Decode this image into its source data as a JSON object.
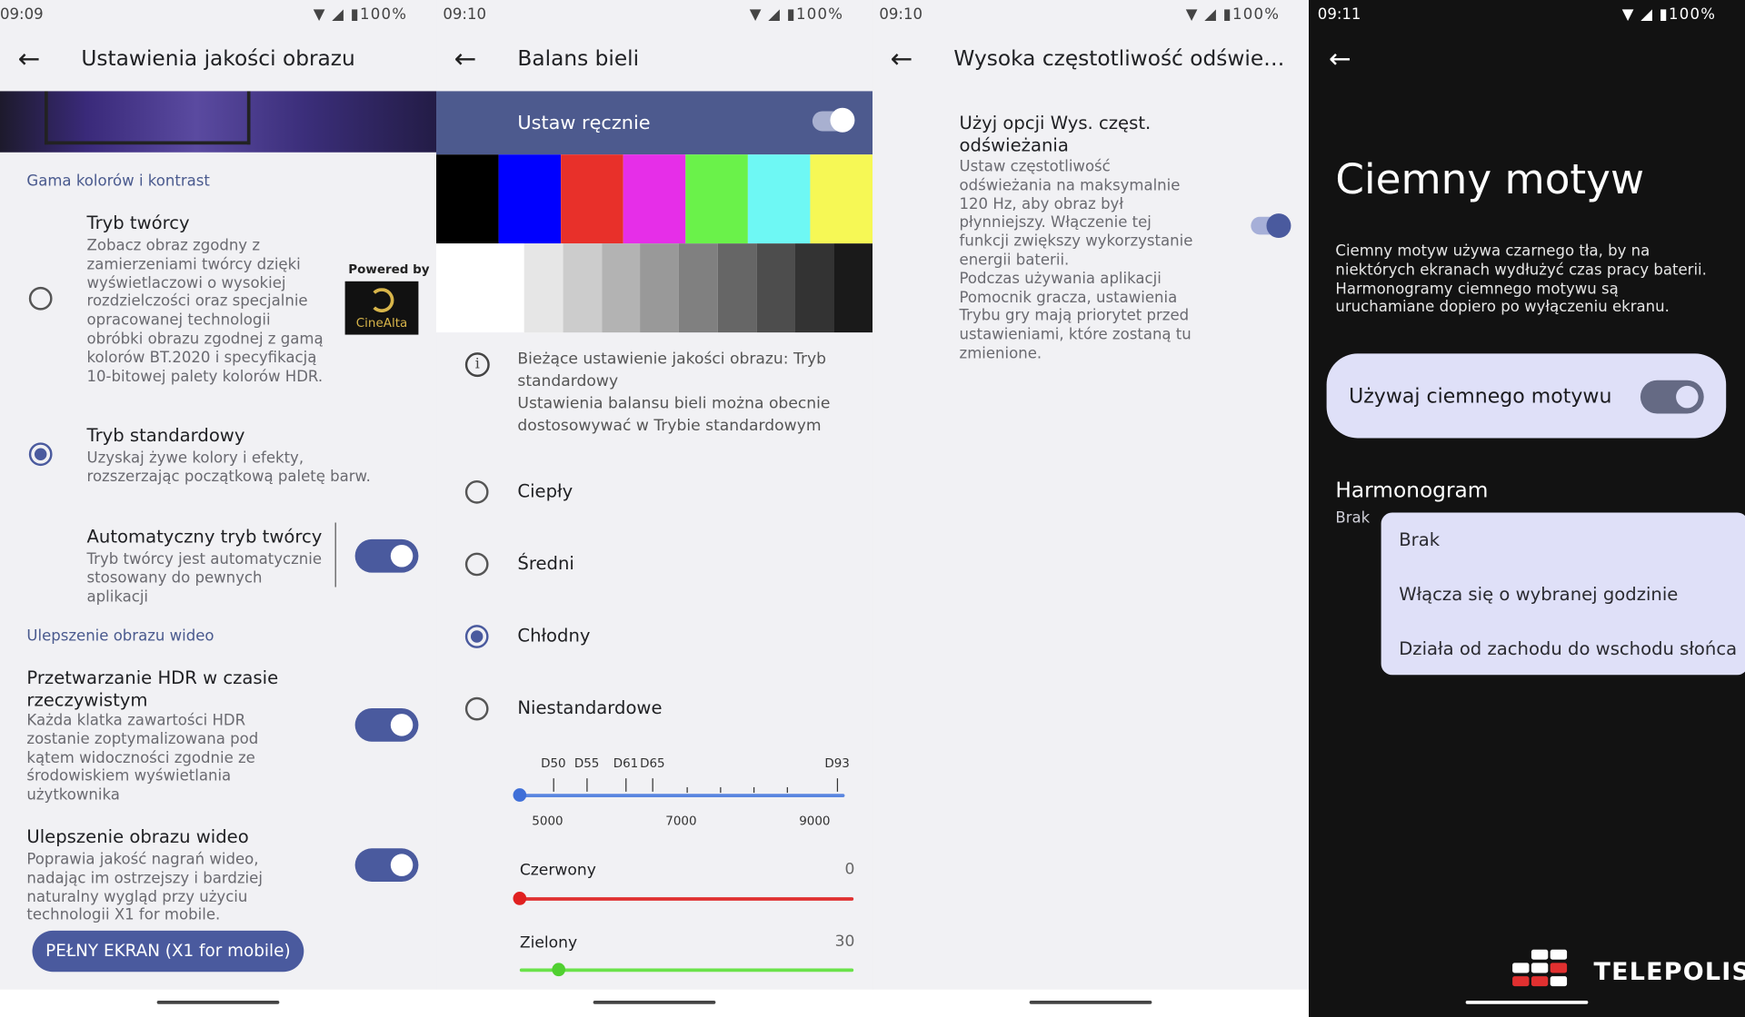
{
  "status": {
    "p1_time": "09:09",
    "p2_time": "09:10",
    "p3_time": "09:10",
    "p4_time": "09:11",
    "battery": "100%"
  },
  "p1": {
    "title": "Ustawienia jakości obrazu",
    "section1": "Gama kolorów i kontrast",
    "creator_title": "Tryb twórcy",
    "creator_desc": "Zobacz obraz zgodny z zamierzeniami twórcy dzięki wyświetlaczowi o wysokiej rozdzielczości oraz specjalnie opracowanej technologii obróbki obrazu zgodnej z gamą kolorów BT.2020 i specyfikacją 10-bitowej palety kolorów HDR.",
    "powered_by": "Powered by",
    "cinealta": "CineAlta",
    "standard_title": "Tryb standardowy",
    "standard_desc": "Uzyskaj żywe kolory i efekty, rozszerzając początkową paletę barw.",
    "auto_title": "Automatyczny tryb twórcy",
    "auto_desc": "Tryb twórcy jest automatycznie stosowany do pewnych aplikacji",
    "section2": "Ulepszenie obrazu wideo",
    "hdr_title": "Przetwarzanie HDR w czasie rzeczywistym",
    "hdr_desc": "Każda klatka zawartości HDR zostanie zoptymalizowana pod kątem widoczności zgodnie ze środowiskiem wyświetlania użytkownika",
    "video_title": "Ulepszenie obrazu wideo",
    "video_desc": "Poprawia jakość nagrań wideo, nadając im ostrzejszy i bardziej naturalny wygląd przy użyciu technologii X1 for mobile.",
    "fullscreen_button": "PEŁNY EKRAN (X1 for mobile)"
  },
  "p2": {
    "title": "Balans bieli",
    "manual_label": "Ustaw ręcznie",
    "info_text": "Bieżące ustawienie jakości obrazu: Tryb standardowy\nUstawienia balansu bieli można obecnie dostosowywać w Trybie standardowym",
    "options": [
      "Ciepły",
      "Średni",
      "Chłodny",
      "Niestandardowe"
    ],
    "selected_option": "Chłodny",
    "temp_labels": [
      "D50",
      "D55",
      "D61",
      "D65",
      "D93"
    ],
    "temp_scale": [
      "5000",
      "7000",
      "9000"
    ],
    "red_label": "Czerwony",
    "red_value": "0",
    "green_label": "Zielony",
    "green_value": "30",
    "color_bars": [
      "#000000",
      "#0000ff",
      "#e8302a",
      "#e62ee8",
      "#6af24a",
      "#6ef8f4",
      "#f6f855"
    ],
    "gray_bars": [
      "#ffffff",
      "#e6e6e6",
      "#cccccc",
      "#b3b3b3",
      "#999999",
      "#808080",
      "#666666",
      "#4d4d4d",
      "#333333",
      "#1a1a1a"
    ]
  },
  "p3": {
    "title": "Wysoka częstotliwość odświe…",
    "option_title": "Użyj opcji Wys. częst. odświeżania",
    "option_desc": "Ustaw częstotliwość odświeżania na maksymalnie 120 Hz, aby obraz był płynniejszy. Włączenie tej funkcji zwiększy wykorzystanie energii baterii.\nPodczas używania aplikacji Pomocnik gracza, ustawienia Trybu gry mają priorytet przed ustawieniami, które zostaną tu zmienione."
  },
  "p4": {
    "title": "Ciemny motyw",
    "desc": "Ciemny motyw używa czarnego tła, by na niektórych ekranach wydłużyć czas pracy baterii. Harmonogramy ciemnego motywu są uruchamiane dopiero po wyłączeniu ekranu.",
    "use_dark": "Używaj ciemnego motywu",
    "schedule_title": "Harmonogram",
    "schedule_value": "Brak",
    "menu": [
      "Brak",
      "Włącza się o wybranej godzinie",
      "Działa od zachodu do wschodu słońca"
    ],
    "brand": "TELEPOLIS"
  }
}
